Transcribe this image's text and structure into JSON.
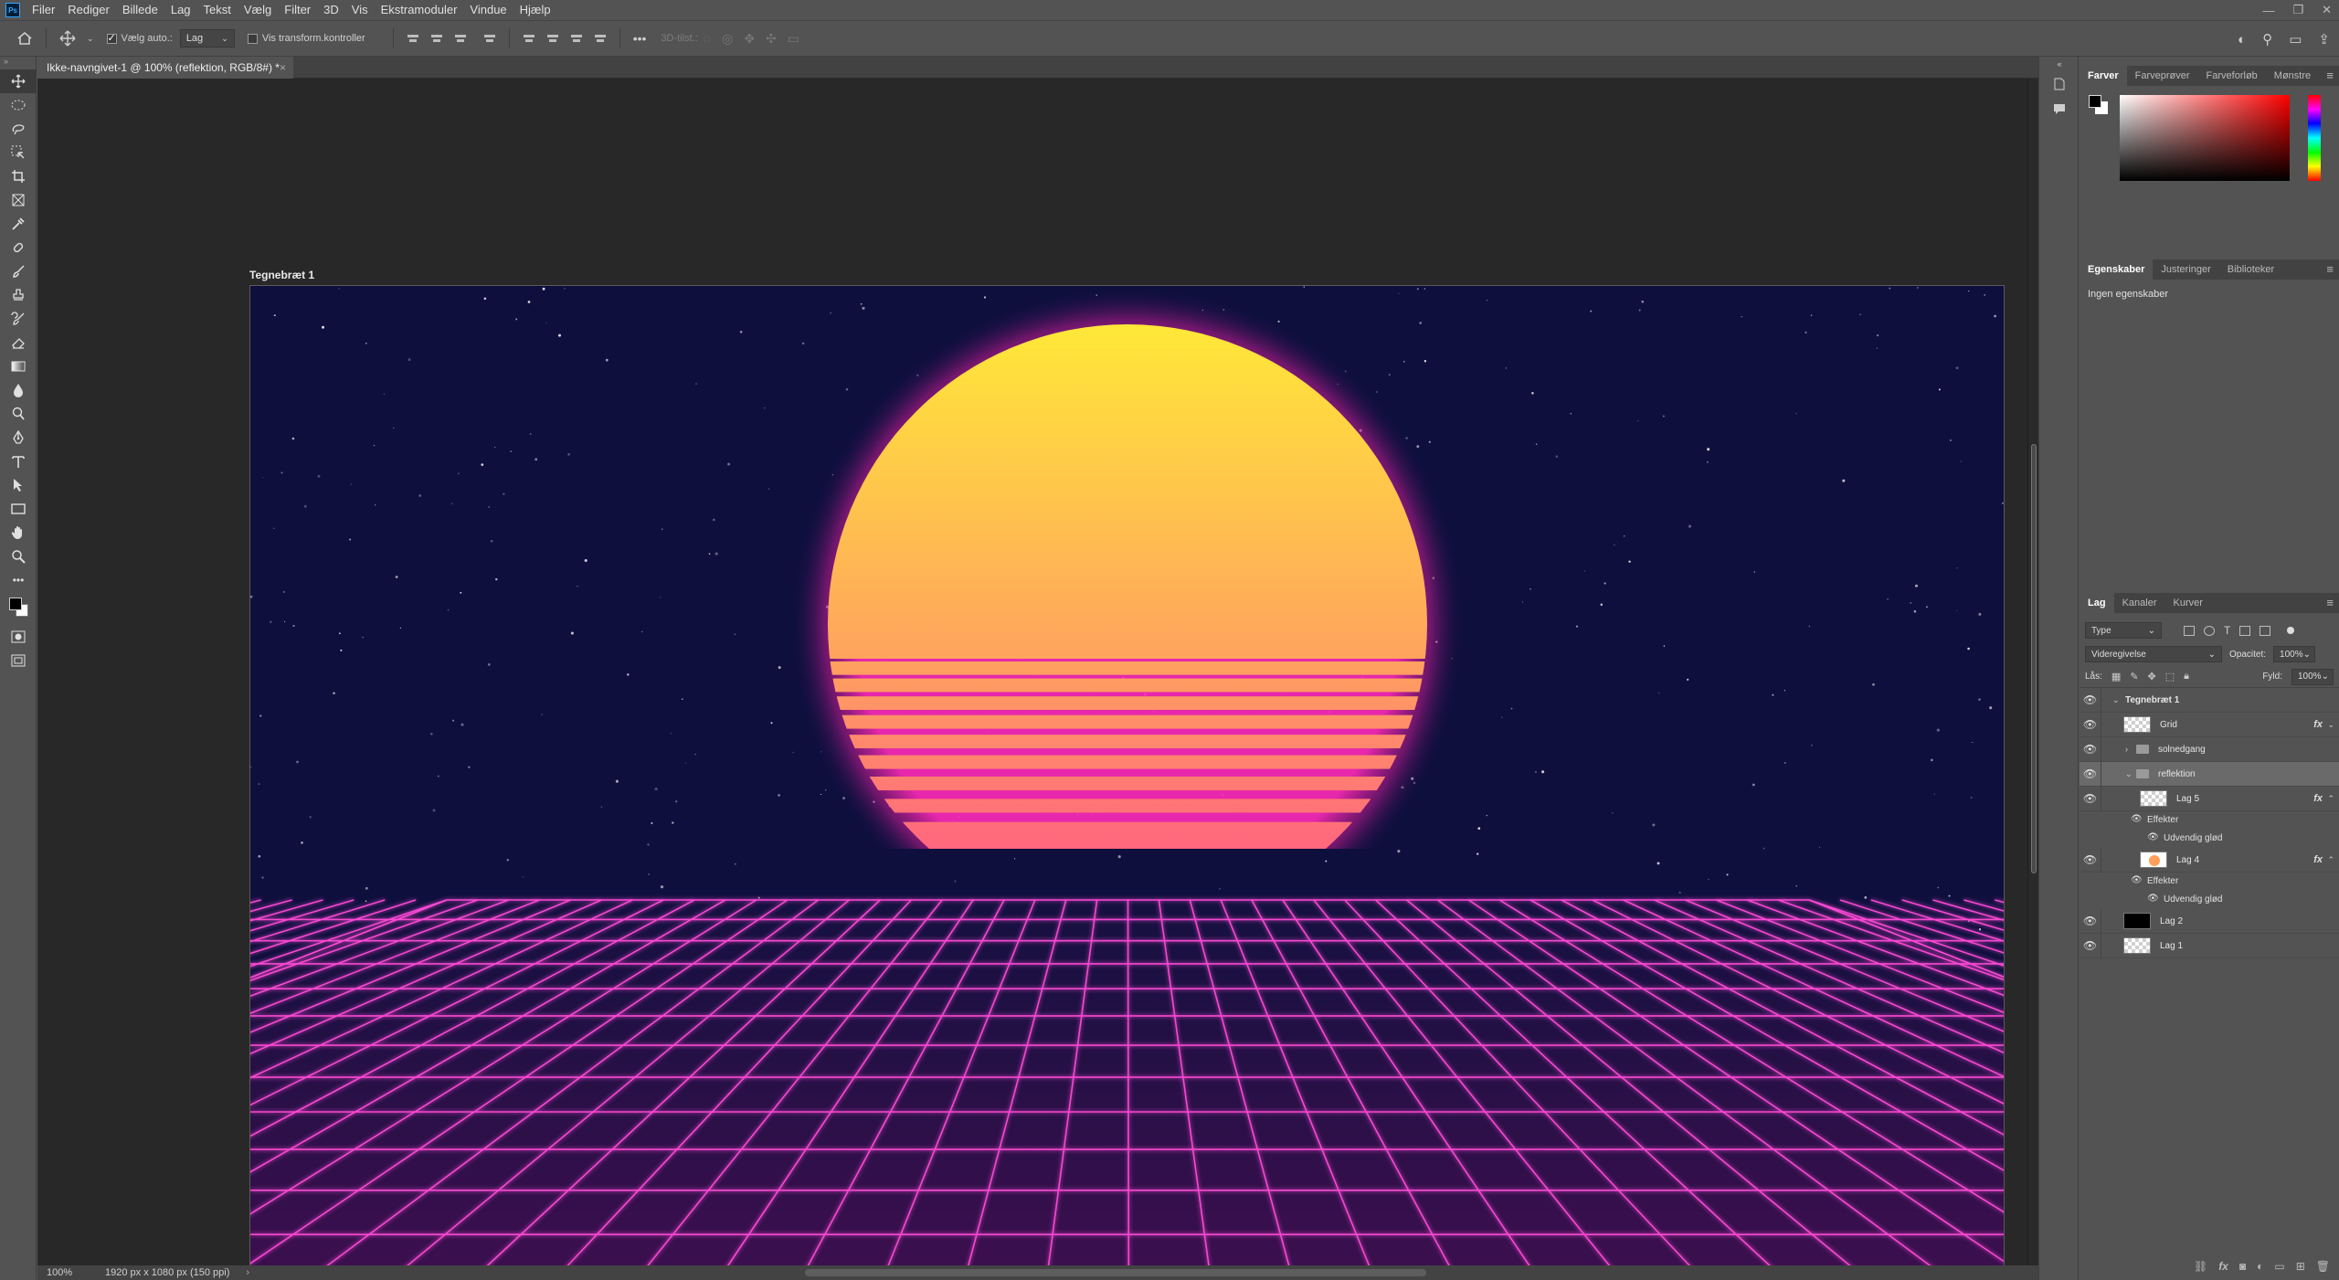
{
  "app": {
    "logo": "Ps",
    "menu": [
      "Filer",
      "Rediger",
      "Billede",
      "Lag",
      "Tekst",
      "Vælg",
      "Filter",
      "3D",
      "Vis",
      "Ekstramoduler",
      "Vindue",
      "Hjælp"
    ],
    "window_controls": [
      "—",
      "❐",
      "✕"
    ]
  },
  "options": {
    "auto_select_label": "Vælg auto.:",
    "auto_select_checked": true,
    "auto_select_target": "Lag",
    "transform_controls_label": "Vis transform.kontroller",
    "transform_controls_checked": false,
    "mode_3d_label": "3D-tilst.:",
    "more": "•••"
  },
  "document": {
    "tab_title": "Ikke-navngivet-1 @ 100% (reflektion, RGB/8#) *",
    "tab_close": "×",
    "artboard_label": "Tegnebræt 1"
  },
  "status": {
    "zoom": "100%",
    "doc_size": "1920 px x 1080 px (150 ppi)",
    "arrow": "›"
  },
  "panels": {
    "color_tabs": [
      "Farver",
      "Farveprøver",
      "Farveforløb",
      "Mønstre"
    ],
    "properties_tabs": [
      "Egenskaber",
      "Justeringer",
      "Biblioteker"
    ],
    "properties_text": "Ingen egenskaber",
    "layers_tabs": [
      "Lag",
      "Kanaler",
      "Kurver"
    ],
    "filter_type": "Type",
    "blend_mode": "Videregivelse",
    "opacity_label": "Opacitet:",
    "opacity_value": "100%",
    "lock_label": "Lås:",
    "fill_label": "Fyld:",
    "fill_value": "100%",
    "menu_glyph": "≡"
  },
  "layers": {
    "artboard": "Tegnebræt 1",
    "grid": "Grid",
    "solnedgang": "solnedgang",
    "reflektion": "reflektion",
    "lag5": "Lag 5",
    "lag4": "Lag 4",
    "lag2": "Lag 2",
    "lag1": "Lag 1",
    "effects": "Effekter",
    "outer_glow": "Udvendig glød",
    "fx": "fx"
  },
  "colors": {
    "ui_bg": "#535353",
    "canvas_bg": "#282828",
    "artboard_sky": "#0e0f3d",
    "sun_top": "#ffe838",
    "sun_bottom": "#ff4f8a",
    "glow": "#ff2bb8",
    "grid_line": "#ff4ad6"
  }
}
